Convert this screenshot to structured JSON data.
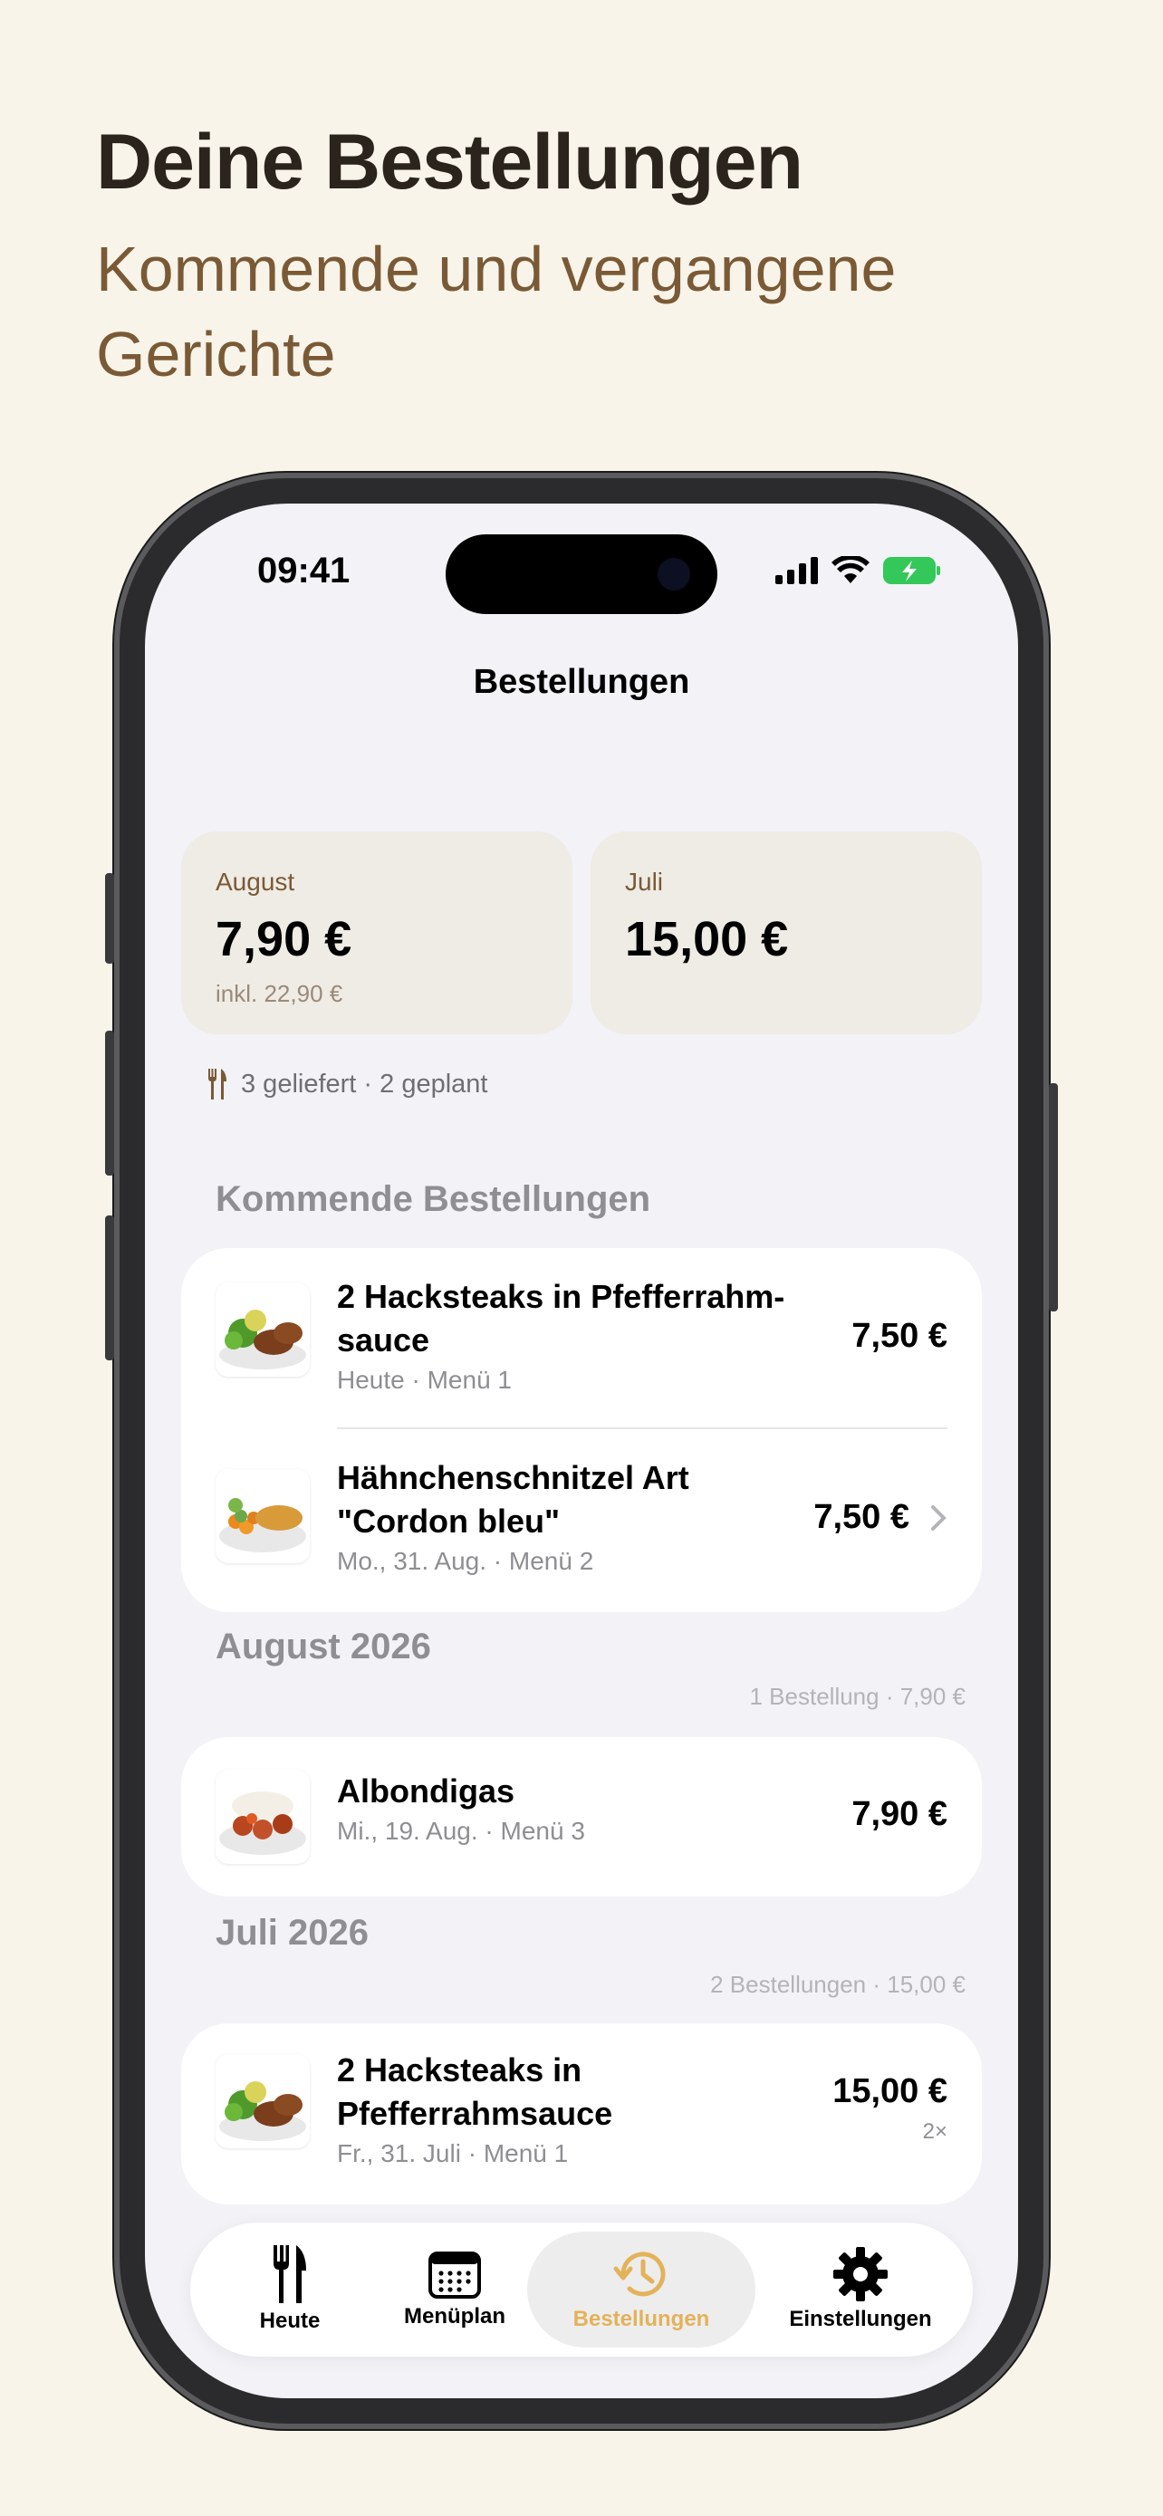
{
  "header": {
    "title": "Deine Bestellungen",
    "subtitle": "Kommende und vergangene Gerichte"
  },
  "status_bar": {
    "time": "09:41"
  },
  "nav": {
    "title": "Bestellungen"
  },
  "summary": [
    {
      "month": "August",
      "amount": "7,90 €",
      "sub": "inkl. 22,90 €"
    },
    {
      "month": "Juli",
      "amount": "15,00 €",
      "sub": ""
    }
  ],
  "delivery_info": "3 geliefert · 2 geplant",
  "sections": {
    "upcoming": {
      "title": "Kommende Bestellungen",
      "items": [
        {
          "title": "2 Hacksteaks in Pfefferrahm-\nsauce",
          "sub": "Heute · Menü 1",
          "price": "7,50 €"
        },
        {
          "title": "Hähnchenschnitzel Art \"Cordon bleu\"",
          "sub": "Mo., 31. Aug. · Menü 2",
          "price": "7,50 €"
        }
      ]
    },
    "august": {
      "title": "August 2026",
      "meta": "1 Bestellung · 7,90 €",
      "items": [
        {
          "title": "Albondigas",
          "sub": "Mi., 19. Aug. · Menü 3",
          "price": "7,90 €"
        }
      ]
    },
    "july": {
      "title": "Juli 2026",
      "meta": "2 Bestellungen · 15,00 €",
      "items": [
        {
          "title": "2 Hacksteaks in Pfefferrahmsauce",
          "sub": "Fr., 31. Juli · Menü 1",
          "price": "15,00 €",
          "qty": "2×"
        }
      ]
    }
  },
  "tabbar": {
    "tabs": [
      {
        "label": "Heute",
        "icon": "fork-knife-icon"
      },
      {
        "label": "Menüplan",
        "icon": "calendar-icon"
      },
      {
        "label": "Bestellungen",
        "icon": "history-icon",
        "active": true
      },
      {
        "label": "Einstellungen",
        "icon": "gear-icon"
      }
    ],
    "active_color": "#e3b25a"
  },
  "colors": {
    "background": "#f8f4ea",
    "headline": "#2a241c",
    "subtitle": "#7a5a36",
    "summary_card": "#efebe5",
    "accent": "#e3b25a"
  }
}
